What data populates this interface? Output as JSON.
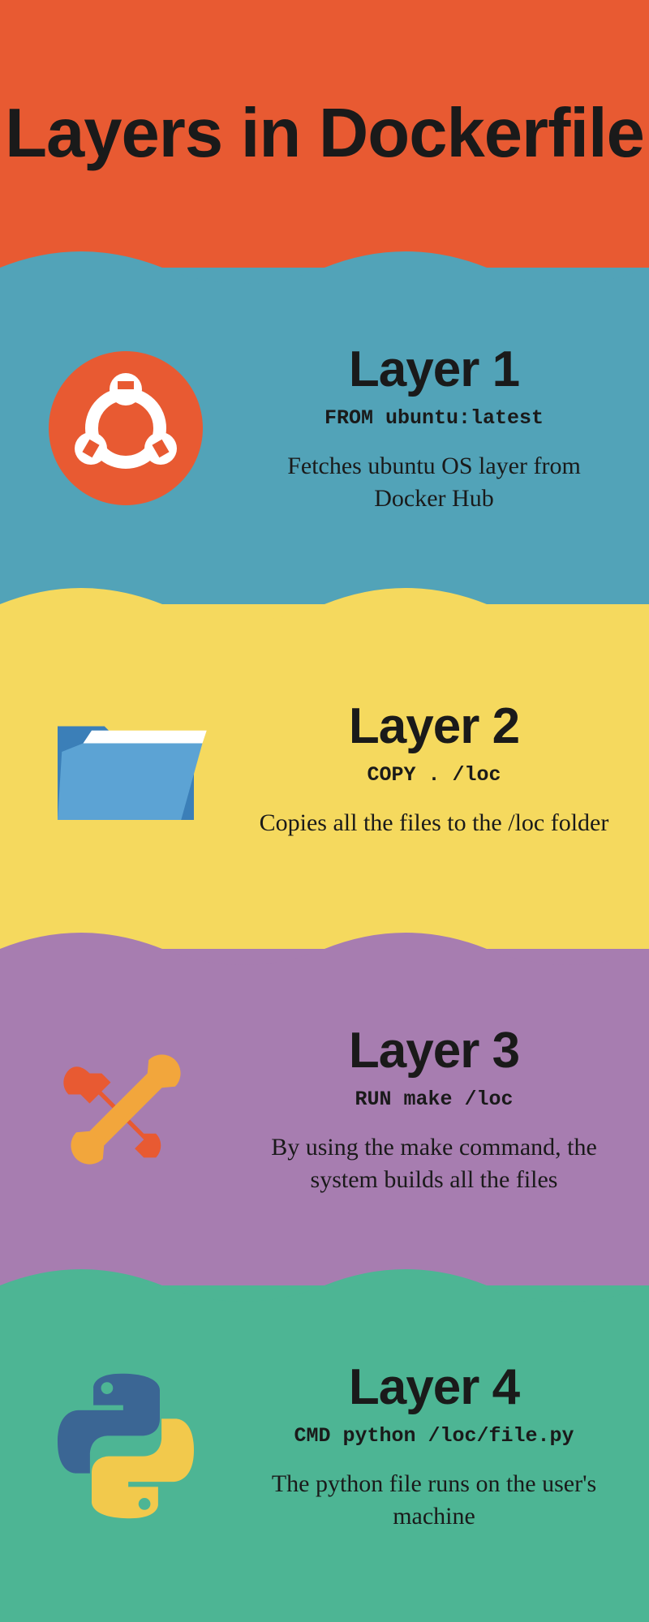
{
  "title": "Layers in Dockerfile",
  "layers": [
    {
      "title": "Layer 1",
      "code": "FROM ubuntu:latest",
      "description": "Fetches ubuntu OS layer from Docker Hub"
    },
    {
      "title": "Layer 2",
      "code": "COPY . /loc",
      "description": "Copies all the files to the /loc folder"
    },
    {
      "title": "Layer 3",
      "code": "RUN make /loc",
      "description": "By using the make command, the system builds all the files"
    },
    {
      "title": "Layer 4",
      "code": "CMD python /loc/file.py",
      "description": "The python file runs on the user's machine"
    }
  ]
}
